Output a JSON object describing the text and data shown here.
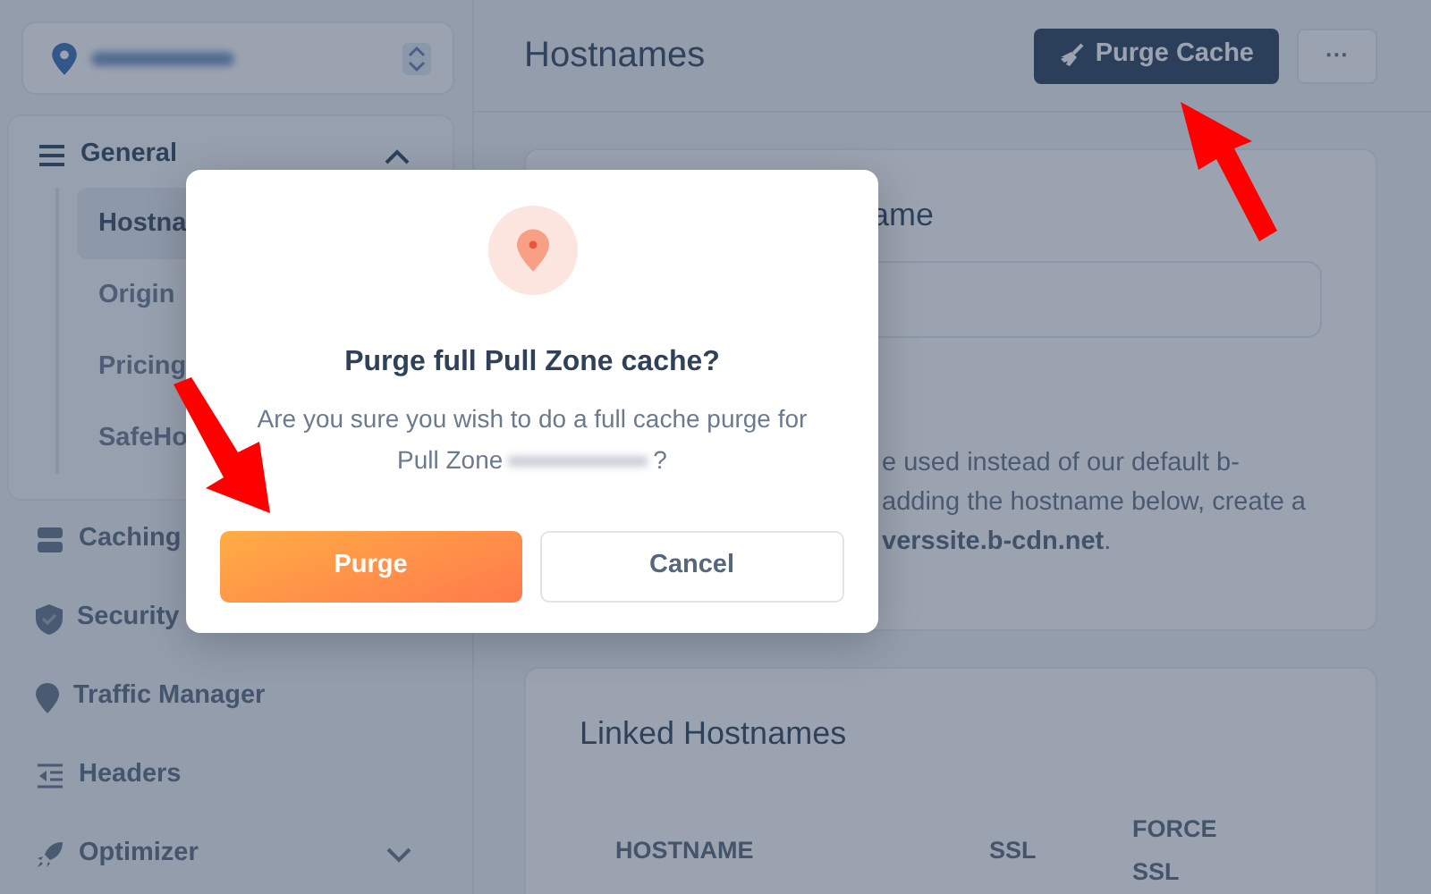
{
  "sidebar": {
    "items": [
      {
        "label": "General",
        "expanded": true,
        "children": [
          {
            "label": "Hostna",
            "selected": true
          },
          {
            "label": "Origin",
            "selected": false
          },
          {
            "label": "Pricing",
            "selected": false
          },
          {
            "label": "SafeHo",
            "selected": false
          }
        ]
      },
      {
        "label": "Caching"
      },
      {
        "label": "Security"
      },
      {
        "label": "Traffic Manager"
      },
      {
        "label": "Headers"
      },
      {
        "label": "Optimizer",
        "expanded": false
      }
    ]
  },
  "header": {
    "title": "Hostnames",
    "purge_button": "Purge Cache",
    "more_button": "···"
  },
  "hostname_card": {
    "title": "ame",
    "description": [
      "e used instead of our default b-",
      "adding the hostname below, create a",
      "**verssite.b-cdn.net**."
    ]
  },
  "linked_card": {
    "title": "Linked Hostnames",
    "columns": [
      "HOSTNAME",
      "SSL",
      "FORCE SSL"
    ]
  },
  "dialog": {
    "title": "Purge full Pull Zone cache?",
    "message": [
      "Are you sure you wish to do a full cache purge for Pull Zone",
      "?"
    ],
    "buttons": [
      {
        "label": "Purge",
        "kind": "primary"
      },
      {
        "label": "Cancel",
        "kind": "secondary"
      }
    ]
  }
}
